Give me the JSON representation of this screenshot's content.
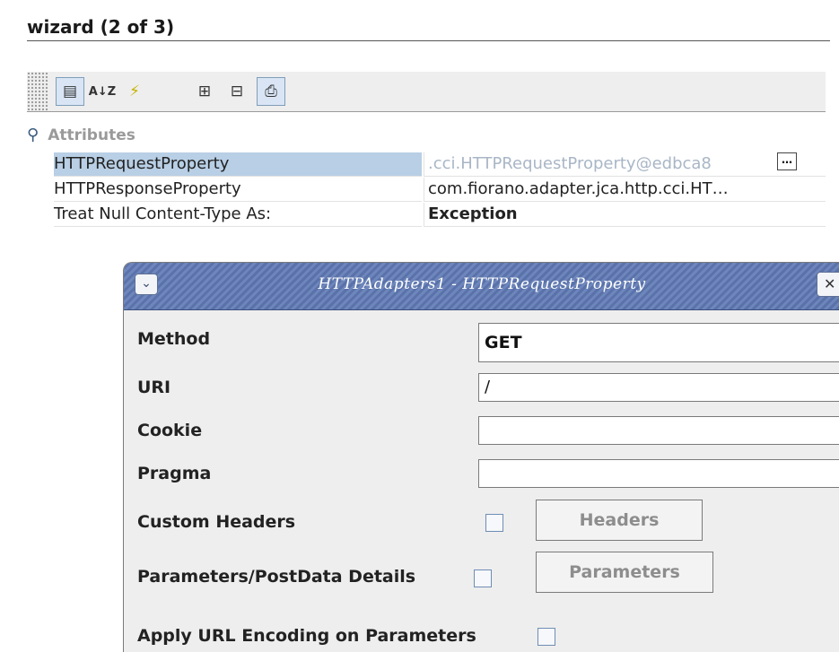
{
  "wizard_title": "wizard (2 of 3)",
  "toolbar": {
    "icons": [
      "categorized-view-icon",
      "sort-alphabetical-icon",
      "events-icon",
      "expand-all-icon",
      "collapse-all-icon",
      "show-description-icon"
    ],
    "glyphs": {
      "categorized": "▤",
      "sort": "A↓Z",
      "events": "⚡",
      "expand": "⊞",
      "collapse": "⊟",
      "description": "⎙"
    }
  },
  "properties": {
    "section_label": "Attributes",
    "rows": [
      {
        "name": "HTTPRequestProperty",
        "value": ".cci.HTTPRequestProperty@edbca8"
      },
      {
        "name": "HTTPResponseProperty",
        "value": "com.fiorano.adapter.jca.http.cci.HT…"
      },
      {
        "name": "Treat Null Content-Type As:",
        "value": "Exception"
      }
    ],
    "ellipsis_label": "…"
  },
  "dialog": {
    "title": "HTTPAdapters1 - HTTPRequestProperty",
    "method_label": "Method",
    "method_value": "GET",
    "uri_label": "URI",
    "uri_value": "/",
    "cookie_label": "Cookie",
    "cookie_value": "",
    "pragma_label": "Pragma",
    "pragma_value": "",
    "custom_headers_label": "Custom Headers",
    "headers_button": "Headers",
    "params_label": "Parameters/PostData Details",
    "params_button": "Parameters",
    "url_encoding_label": "Apply URL Encoding on Parameters",
    "checkboxes": {
      "custom_headers": false,
      "params": false,
      "url_encoding": false
    }
  },
  "colors": {
    "selection": "#b8cfe5",
    "titlebar": "#6d86bc"
  }
}
